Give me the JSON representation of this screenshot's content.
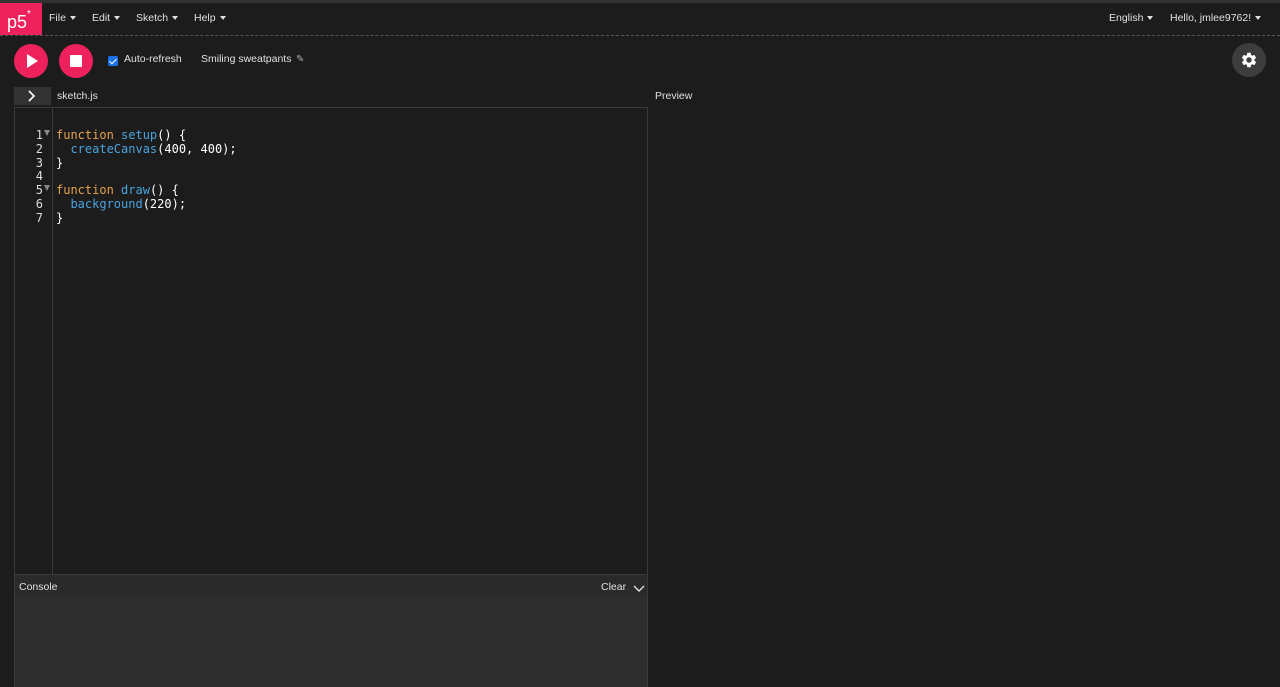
{
  "app": {
    "logo": "p5",
    "logo_mark": "*"
  },
  "nav": {
    "menus": [
      {
        "label": "File"
      },
      {
        "label": "Edit"
      },
      {
        "label": "Sketch"
      },
      {
        "label": "Help"
      }
    ],
    "language": "English",
    "user_greeting": "Hello, jmlee9762!"
  },
  "toolbar": {
    "play_icon": "play-icon",
    "stop_icon": "stop-icon",
    "auto_refresh_label": "Auto-refresh",
    "auto_refresh_checked": true,
    "sketch_name": "Smiling sweatpants",
    "edit_icon": "pencil-icon",
    "settings_icon": "gear-icon"
  },
  "editor": {
    "file_name": "sketch.js",
    "lines": [
      {
        "num": "1",
        "tokens": [
          {
            "t": "function",
            "c": "kw"
          },
          {
            "t": " ",
            "c": ""
          },
          {
            "t": "setup",
            "c": "fn"
          },
          {
            "t": "() {",
            "c": ""
          }
        ],
        "fold": true
      },
      {
        "num": "2",
        "tokens": [
          {
            "t": "  ",
            "c": ""
          },
          {
            "t": "createCanvas",
            "c": "fn"
          },
          {
            "t": "(400, 400);",
            "c": ""
          }
        ],
        "fold": false
      },
      {
        "num": "3",
        "tokens": [
          {
            "t": "}",
            "c": ""
          }
        ],
        "fold": false
      },
      {
        "num": "4",
        "tokens": [],
        "fold": false
      },
      {
        "num": "5",
        "tokens": [
          {
            "t": "function",
            "c": "kw"
          },
          {
            "t": " ",
            "c": ""
          },
          {
            "t": "draw",
            "c": "fn"
          },
          {
            "t": "() {",
            "c": ""
          }
        ],
        "fold": true
      },
      {
        "num": "6",
        "tokens": [
          {
            "t": "  ",
            "c": ""
          },
          {
            "t": "background",
            "c": "fn"
          },
          {
            "t": "(220);",
            "c": ""
          }
        ],
        "fold": false
      },
      {
        "num": "7",
        "tokens": [
          {
            "t": "}",
            "c": ""
          }
        ],
        "fold": false
      }
    ]
  },
  "preview": {
    "label": "Preview"
  },
  "console": {
    "title": "Console",
    "clear_label": "Clear"
  },
  "colors": {
    "accent": "#ed225d",
    "keyword": "#e6a14c",
    "function": "#4aa3df",
    "checkbox": "#1a73e8"
  }
}
